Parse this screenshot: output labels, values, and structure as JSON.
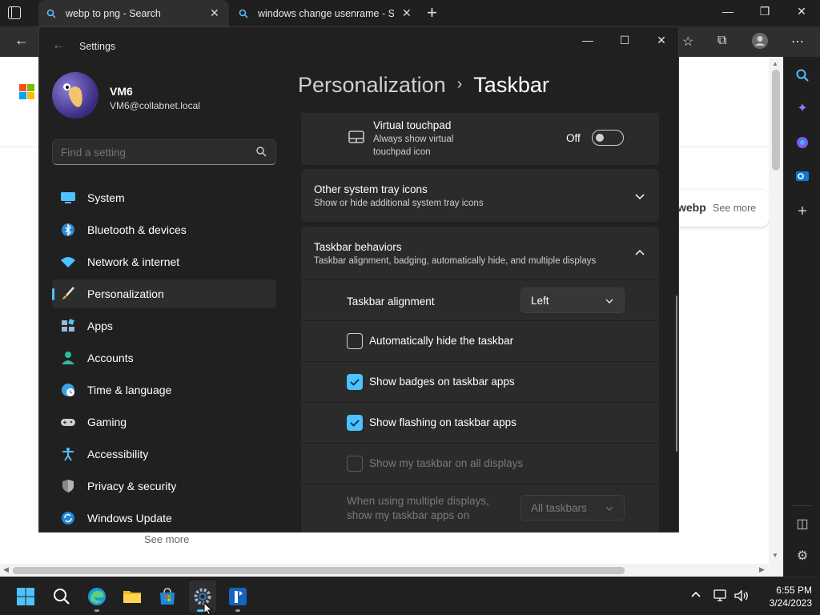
{
  "browser": {
    "tabs": [
      {
        "title": "webp to png - Search",
        "active": true
      },
      {
        "title": "windows change usenrame - Sea",
        "active": false
      }
    ],
    "new_tab": "+",
    "page": {
      "card_brand": "webp",
      "card_more": "See more",
      "see_more": "See more"
    }
  },
  "settings": {
    "app_title": "Settings",
    "user": {
      "name": "VM6",
      "email": "VM6@collabnet.local"
    },
    "search_placeholder": "Find a setting",
    "nav": [
      {
        "label": "System",
        "icon": "monitor-icon"
      },
      {
        "label": "Bluetooth & devices",
        "icon": "bluetooth-icon"
      },
      {
        "label": "Network & internet",
        "icon": "wifi-icon"
      },
      {
        "label": "Personalization",
        "icon": "brush-icon",
        "selected": true
      },
      {
        "label": "Apps",
        "icon": "apps-icon"
      },
      {
        "label": "Accounts",
        "icon": "person-icon"
      },
      {
        "label": "Time & language",
        "icon": "globe-clock-icon"
      },
      {
        "label": "Gaming",
        "icon": "controller-icon"
      },
      {
        "label": "Accessibility",
        "icon": "accessibility-icon"
      },
      {
        "label": "Privacy & security",
        "icon": "shield-icon"
      },
      {
        "label": "Windows Update",
        "icon": "update-icon"
      }
    ],
    "breadcrumb": {
      "parent": "Personalization",
      "sep": "›",
      "current": "Taskbar"
    },
    "virtual_touchpad": {
      "title": "Virtual touchpad",
      "subtitle_line1": "Always show virtual",
      "subtitle_line2": "touchpad icon",
      "state": "Off"
    },
    "other_tray": {
      "title": "Other system tray icons",
      "subtitle": "Show or hide additional system tray icons"
    },
    "behaviors": {
      "title": "Taskbar behaviors",
      "subtitle": "Taskbar alignment, badging, automatically hide, and multiple displays",
      "alignment_label": "Taskbar alignment",
      "alignment_value": "Left",
      "auto_hide": {
        "label": "Automatically hide the taskbar",
        "checked": false
      },
      "badges": {
        "label": "Show badges on taskbar apps",
        "checked": true
      },
      "flashing": {
        "label": "Show flashing on taskbar apps",
        "checked": true
      },
      "all_displays": {
        "label": "Show my taskbar on all displays",
        "checked": false,
        "disabled": true
      },
      "multi_label_line1": "When using multiple displays,",
      "multi_label_line2": "show my taskbar apps on",
      "multi_value": "All taskbars"
    }
  },
  "taskbar": {
    "time": "6:55 PM",
    "date": "3/24/2023"
  },
  "colors": {
    "accent": "#4cc2ff",
    "settings_bg": "#202020",
    "card_bg": "#2b2b2b"
  }
}
